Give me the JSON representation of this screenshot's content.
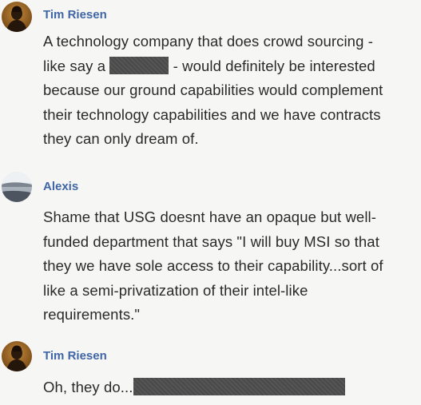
{
  "messages": [
    {
      "author": "Tim Riesen",
      "avatar_icon": "person-portrait-avatar",
      "lines": {
        "l1": "A technology company that does crowd sourcing -",
        "l2_before": "like say a",
        "l2_after": "- would definitely be interested",
        "l3": "because our ground capabilities would complement",
        "l4": "their technology capabilities and we have contracts",
        "l5": "they can only dream of."
      }
    },
    {
      "author": "Alexis",
      "avatar_icon": "landscape-avatar",
      "lines": {
        "l1": "Shame that USG doesnt have an opaque but well-",
        "l2": "funded department that says \"I will buy MSI so that",
        "l3": "they we have sole access to their capability...sort of",
        "l4": "like a semi-privatization of their intel-like",
        "l5": "requirements.\""
      }
    },
    {
      "author": "Tim Riesen",
      "avatar_icon": "person-portrait-avatar",
      "lines": {
        "l1_before": "Oh, they do..."
      }
    }
  ],
  "colors": {
    "author": "#3f66a6",
    "text": "#2a2a2a",
    "background": "#f6f6f4",
    "redaction": "#4e4e4e"
  }
}
